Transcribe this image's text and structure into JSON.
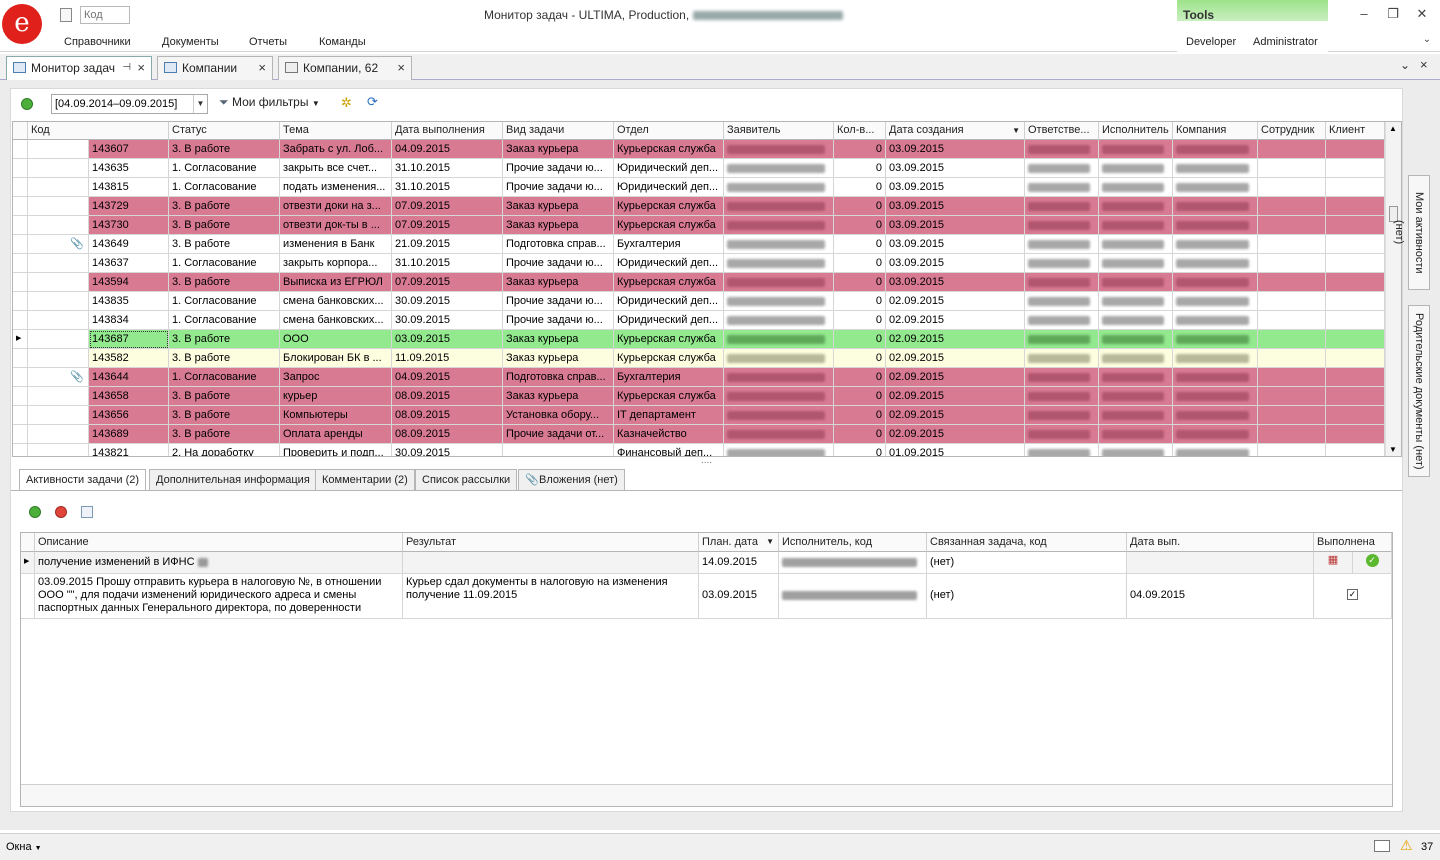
{
  "app": {
    "logo_letter": "e",
    "code_placeholder": "Код",
    "title": "Монитор задач - ULTIMA, Production,",
    "menu": [
      "Справочники",
      "Документы",
      "Отчеты",
      "Команды"
    ],
    "tools": {
      "label": "Tools",
      "developer": "Developer",
      "administrator": "Administrator"
    }
  },
  "doc_tabs": [
    {
      "label": "Монитор задач",
      "pin": "⊣",
      "close": "×"
    },
    {
      "label": "Компании",
      "close": "×"
    },
    {
      "label": "Компании, 62",
      "close": "×"
    }
  ],
  "toolbar": {
    "date_range": "[04.09.2014–09.09.2015]",
    "filters_label": "Мои фильтры"
  },
  "grid": {
    "columns": [
      "Код",
      "Статус",
      "Тема",
      "Дата выполнения",
      "Вид задачи",
      "Отдел",
      "Заявитель",
      "Кол-в...",
      "Дата создания",
      "Ответстве...",
      "Исполнитель",
      "Компания",
      "Сотрудник",
      "Клиент"
    ],
    "rows": [
      {
        "code": "143607",
        "status": "3. В работе",
        "theme": "Забрать с ул. Лоб...",
        "due": "04.09.2015",
        "kind": "Заказ курьера",
        "dept": "Курьерская служба",
        "qty": "0",
        "created": "03.09.2015",
        "style": "red",
        "attach": ""
      },
      {
        "code": "143635",
        "status": "1. Согласование",
        "theme": "закрыть все счет...",
        "due": "31.10.2015",
        "kind": "Прочие задачи ю...",
        "dept": "Юридический деп...",
        "qty": "0",
        "created": "03.09.2015",
        "style": "white",
        "attach": ""
      },
      {
        "code": "143815",
        "status": "1. Согласование",
        "theme": "подать изменения...",
        "due": "31.10.2015",
        "kind": "Прочие задачи ю...",
        "dept": "Юридический деп...",
        "qty": "0",
        "created": "03.09.2015",
        "style": "white",
        "attach": ""
      },
      {
        "code": "143729",
        "status": "3. В работе",
        "theme": "отвезти доки на з...",
        "due": "07.09.2015",
        "kind": "Заказ курьера",
        "dept": "Курьерская служба",
        "qty": "0",
        "created": "03.09.2015",
        "style": "red",
        "attach": ""
      },
      {
        "code": "143730",
        "status": "3. В работе",
        "theme": "отвезти док-ты в ...",
        "due": "07.09.2015",
        "kind": "Заказ курьера",
        "dept": "Курьерская служба",
        "qty": "0",
        "created": "03.09.2015",
        "style": "red",
        "attach": ""
      },
      {
        "code": "143649",
        "status": "3. В работе",
        "theme": "изменения в Банк",
        "due": "21.09.2015",
        "kind": "Подготовка справ...",
        "dept": "Бухгалтерия",
        "qty": "0",
        "created": "03.09.2015",
        "style": "white",
        "attach": "📎"
      },
      {
        "code": "143637",
        "status": "1. Согласование",
        "theme": "закрыть корпора...",
        "due": "31.10.2015",
        "kind": "Прочие задачи ю...",
        "dept": "Юридический деп...",
        "qty": "0",
        "created": "03.09.2015",
        "style": "white",
        "attach": ""
      },
      {
        "code": "143594",
        "status": "3. В работе",
        "theme": "Выписка из ЕГРЮЛ",
        "due": "07.09.2015",
        "kind": "Заказ курьера",
        "dept": "Курьерская служба",
        "qty": "0",
        "created": "03.09.2015",
        "style": "red",
        "attach": ""
      },
      {
        "code": "143835",
        "status": "1. Согласование",
        "theme": "смена банковских...",
        "due": "30.09.2015",
        "kind": "Прочие задачи ю...",
        "dept": "Юридический деп...",
        "qty": "0",
        "created": "02.09.2015",
        "style": "white",
        "attach": ""
      },
      {
        "code": "143834",
        "status": "1. Согласование",
        "theme": "смена банковских...",
        "due": "30.09.2015",
        "kind": "Прочие задачи ю...",
        "dept": "Юридический деп...",
        "qty": "0",
        "created": "02.09.2015",
        "style": "white",
        "attach": ""
      },
      {
        "code": "143687",
        "status": "3. В работе",
        "theme": "ООО",
        "due": "03.09.2015",
        "kind": "Заказ курьера",
        "dept": "Курьерская служба",
        "qty": "0",
        "created": "02.09.2015",
        "style": "green",
        "attach": "",
        "current": true
      },
      {
        "code": "143582",
        "status": "3. В работе",
        "theme": "Блокирован БК в ...",
        "due": "11.09.2015",
        "kind": "Заказ курьера",
        "dept": "Курьерская служба",
        "qty": "0",
        "created": "02.09.2015",
        "style": "yellow",
        "attach": ""
      },
      {
        "code": "143644",
        "status": "1. Согласование",
        "theme": "Запрос",
        "due": "04.09.2015",
        "kind": "Подготовка справ...",
        "dept": "Бухгалтерия",
        "qty": "0",
        "created": "02.09.2015",
        "style": "red",
        "attach": "📎"
      },
      {
        "code": "143658",
        "status": "3. В работе",
        "theme": "курьер",
        "due": "08.09.2015",
        "kind": "Заказ курьера",
        "dept": "Курьерская служба",
        "qty": "0",
        "created": "02.09.2015",
        "style": "red",
        "attach": ""
      },
      {
        "code": "143656",
        "status": "3. В работе",
        "theme": "Компьютеры",
        "due": "08.09.2015",
        "kind": "Установка обору...",
        "dept": "IT департамент",
        "qty": "0",
        "created": "02.09.2015",
        "style": "red",
        "attach": ""
      },
      {
        "code": "143689",
        "status": "3. В работе",
        "theme": "Оплата аренды",
        "due": "08.09.2015",
        "kind": "Прочие задачи от...",
        "dept": "Казначейство",
        "qty": "0",
        "created": "02.09.2015",
        "style": "red",
        "attach": ""
      },
      {
        "code": "143821",
        "status": "2. На доработку",
        "theme": "Проверить и подп...",
        "due": "30.09.2015",
        "kind": "",
        "dept": "Финансовый деп...",
        "qty": "0",
        "created": "01.09.2015",
        "style": "white",
        "attach": ""
      }
    ]
  },
  "side_tabs": [
    "Мои активности (нет)",
    "Родительские документы (нет)"
  ],
  "sub_tabs": [
    "Активности задачи (2)",
    "Дополнительная информация",
    "Комментарии (2)",
    "Список рассылки",
    "Вложения (нет)"
  ],
  "activities": {
    "columns": [
      "Описание",
      "Результат",
      "План. дата",
      "Исполнитель, код",
      "Связанная задача, код",
      "Дата вып.",
      "Выполнена"
    ],
    "rows": [
      {
        "desc": "получение изменений в ИФНС",
        "result": "",
        "plan": "14.09.2015",
        "linked": "(нет)",
        "done_date": "",
        "done": ""
      },
      {
        "desc": "03.09.2015 Прошу отправить курьера в налоговую №, в отношении ООО \"\", для подачи изменений юридического адреса и смены паспортных данных Генерального директора, по доверенности",
        "result": "Курьер сдал документы в налоговую на изменения получение 11.09.2015",
        "plan": "03.09.2015",
        "linked": "(нет)",
        "done_date": "04.09.2015",
        "done": "✓"
      }
    ]
  },
  "status": {
    "windows": "Окна",
    "count": "37"
  }
}
